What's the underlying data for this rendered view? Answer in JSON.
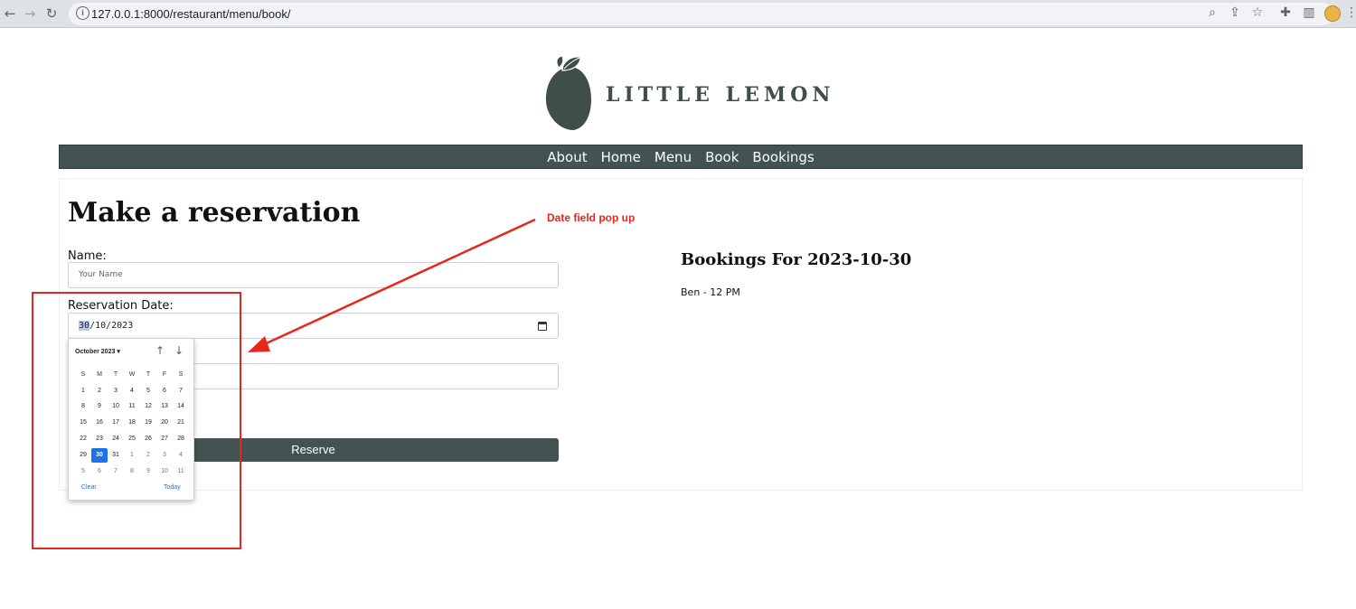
{
  "browser": {
    "url": "127.0.0.1:8000/restaurant/menu/book/"
  },
  "logo": {
    "brand": "LITTLE LEMON",
    "colors": {
      "brand": "#3f4e49"
    }
  },
  "nav": {
    "items": [
      "About",
      "Home",
      "Menu",
      "Book",
      "Bookings"
    ],
    "colors": {
      "background": "#435351"
    }
  },
  "form": {
    "heading": "Make a reservation",
    "name_label": "Name:",
    "name_placeholder": "Your Name",
    "date_label": "Reservation Date:",
    "date_value": {
      "day": "30",
      "rest": "/10/2023"
    },
    "reserve_label": "Reserve"
  },
  "bookings": {
    "title": "Bookings For 2023-10-30",
    "items": [
      "Ben - 12 PM"
    ]
  },
  "datepicker": {
    "month_label": "October 2023",
    "weekdays": [
      "S",
      "M",
      "T",
      "W",
      "T",
      "F",
      "S"
    ],
    "weeks": [
      [
        "1",
        "2",
        "3",
        "4",
        "5",
        "6",
        "7"
      ],
      [
        "8",
        "9",
        "10",
        "11",
        "12",
        "13",
        "14"
      ],
      [
        "15",
        "16",
        "17",
        "18",
        "19",
        "20",
        "21"
      ],
      [
        "22",
        "23",
        "24",
        "25",
        "26",
        "27",
        "28"
      ],
      [
        "29",
        "30",
        "31",
        "1",
        "2",
        "3",
        "4"
      ],
      [
        "5",
        "6",
        "7",
        "8",
        "9",
        "10",
        "11"
      ]
    ],
    "selected_day": "30",
    "clear_label": "Clear",
    "today_label": "Today",
    "colors": {
      "accent": "#1a73e8"
    }
  },
  "annotation": {
    "text": "Date field pop up",
    "color": "#e8261c"
  }
}
